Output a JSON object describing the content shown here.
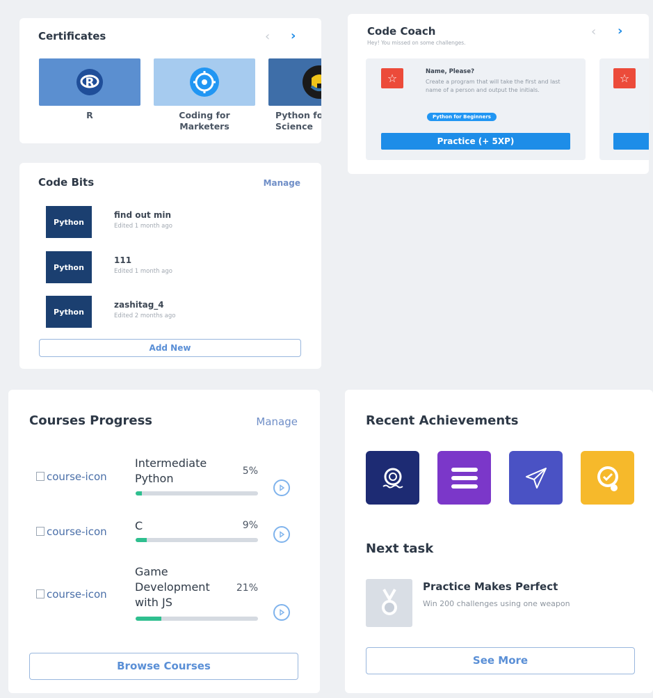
{
  "certificates": {
    "title": "Certificates",
    "prev_icon": "chevron-left-icon",
    "next_icon": "chevron-right-icon",
    "items": [
      {
        "label": "R",
        "color": "#5b8fd0"
      },
      {
        "label": "Coding for Marketers",
        "color": "#a6cbef"
      },
      {
        "label": "Python for Data Science",
        "color": "#3e6ea8"
      }
    ]
  },
  "code_coach": {
    "title": "Code Coach",
    "subtitle": "Hey! You missed on some challenges.",
    "challenge": {
      "title": "Name, Please?",
      "description": "Create a program that will take the first and last name of a person and output the initials.",
      "tag": "Python for Beginners",
      "button": "Practice (+ 5XP)"
    }
  },
  "code_bits": {
    "title": "Code Bits",
    "manage": "Manage",
    "items": [
      {
        "lang": "Python",
        "name": "find out min",
        "edited": "Edited 1 month ago"
      },
      {
        "lang": "Python",
        "name": "111",
        "edited": "Edited 1 month ago"
      },
      {
        "lang": "Python",
        "name": "zashitag_4",
        "edited": "Edited 2 months ago"
      }
    ],
    "add_new": "Add New"
  },
  "courses": {
    "title": "Courses Progress",
    "manage": "Manage",
    "icon_alt": "course-icon",
    "items": [
      {
        "name": "Intermediate Python",
        "percent_text": "5%",
        "progress": 0.05
      },
      {
        "name": "C",
        "percent_text": "9%",
        "progress": 0.09
      },
      {
        "name": "Game Development with JS",
        "percent_text": "21%",
        "progress": 0.21
      }
    ],
    "browse": "Browse Courses"
  },
  "achievements": {
    "title": "Recent Achievements",
    "badges": [
      {
        "icon": "lifebuoy-icon",
        "color": "#1d2b73"
      },
      {
        "icon": "menu-lines-icon",
        "color": "#7b37c9"
      },
      {
        "icon": "paper-plane-icon",
        "color": "#4a52c4"
      },
      {
        "icon": "gear-check-icon",
        "color": "#f6b92b"
      }
    ],
    "next_task_title": "Next task",
    "task": {
      "title": "Practice Makes Perfect",
      "description": "Win 200 challenges using one weapon"
    },
    "see_more": "See More"
  },
  "colors": {
    "accent": "#1d8de8",
    "progress": "#2fbf8f",
    "background": "#eef0f3"
  }
}
